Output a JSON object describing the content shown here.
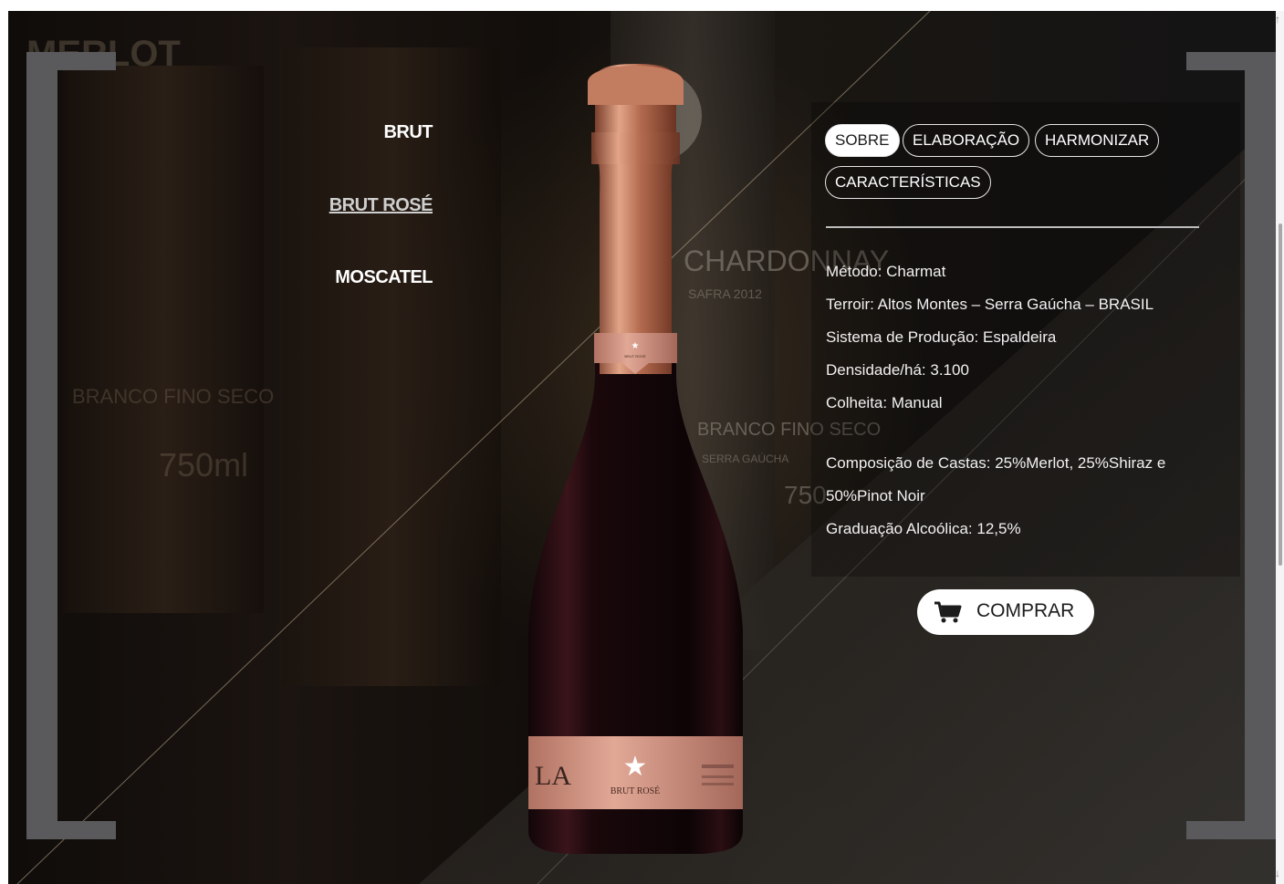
{
  "nav": {
    "variants": [
      "BRUT",
      "BRUT ROSÉ",
      "MOSCATEL"
    ],
    "active_variant": "BRUT ROSÉ"
  },
  "tabs": [
    {
      "label": "SOBRE",
      "active": true
    },
    {
      "label": "ELABORAÇÃO",
      "active": false
    },
    {
      "label": "HARMONIZAR",
      "active": false
    },
    {
      "label": "CARACTERÍSTICAS",
      "active": false
    }
  ],
  "specs": [
    "Método: Charmat",
    "Terroir: Altos Montes – Serra Gaúcha – BRASIL",
    "Sistema de Produção: Espaldeira",
    "Densidade/há: 3.100",
    "Colheita: Manual",
    "Composição de Castas: 25%Merlot, 25%Shiraz e",
    "50%Pinot Noir",
    "Graduação Alcoólica: 12,5%"
  ],
  "bottle": {
    "label_name": "BRUT ROSÉ",
    "logo": "LA",
    "neck_text": "BRUT ROSÉ"
  },
  "background_text": {
    "top_left": "MERLOT",
    "mid": "CHARDONNAY",
    "safra": "SAFRA 2012",
    "left_label": "BRANCO FINO SECO",
    "left_volume": "750ml",
    "right_label": "BRANCO FINO SECO",
    "right_region": "SERRA GAÚCHA",
    "right_volume": "750"
  },
  "buy": {
    "label": "COMPRAR",
    "icon": "cart-icon"
  },
  "colors": {
    "accent_copper": "#c98a6f",
    "bracket_gray": "#5a5a5c",
    "pill_active_bg": "#ffffff"
  }
}
